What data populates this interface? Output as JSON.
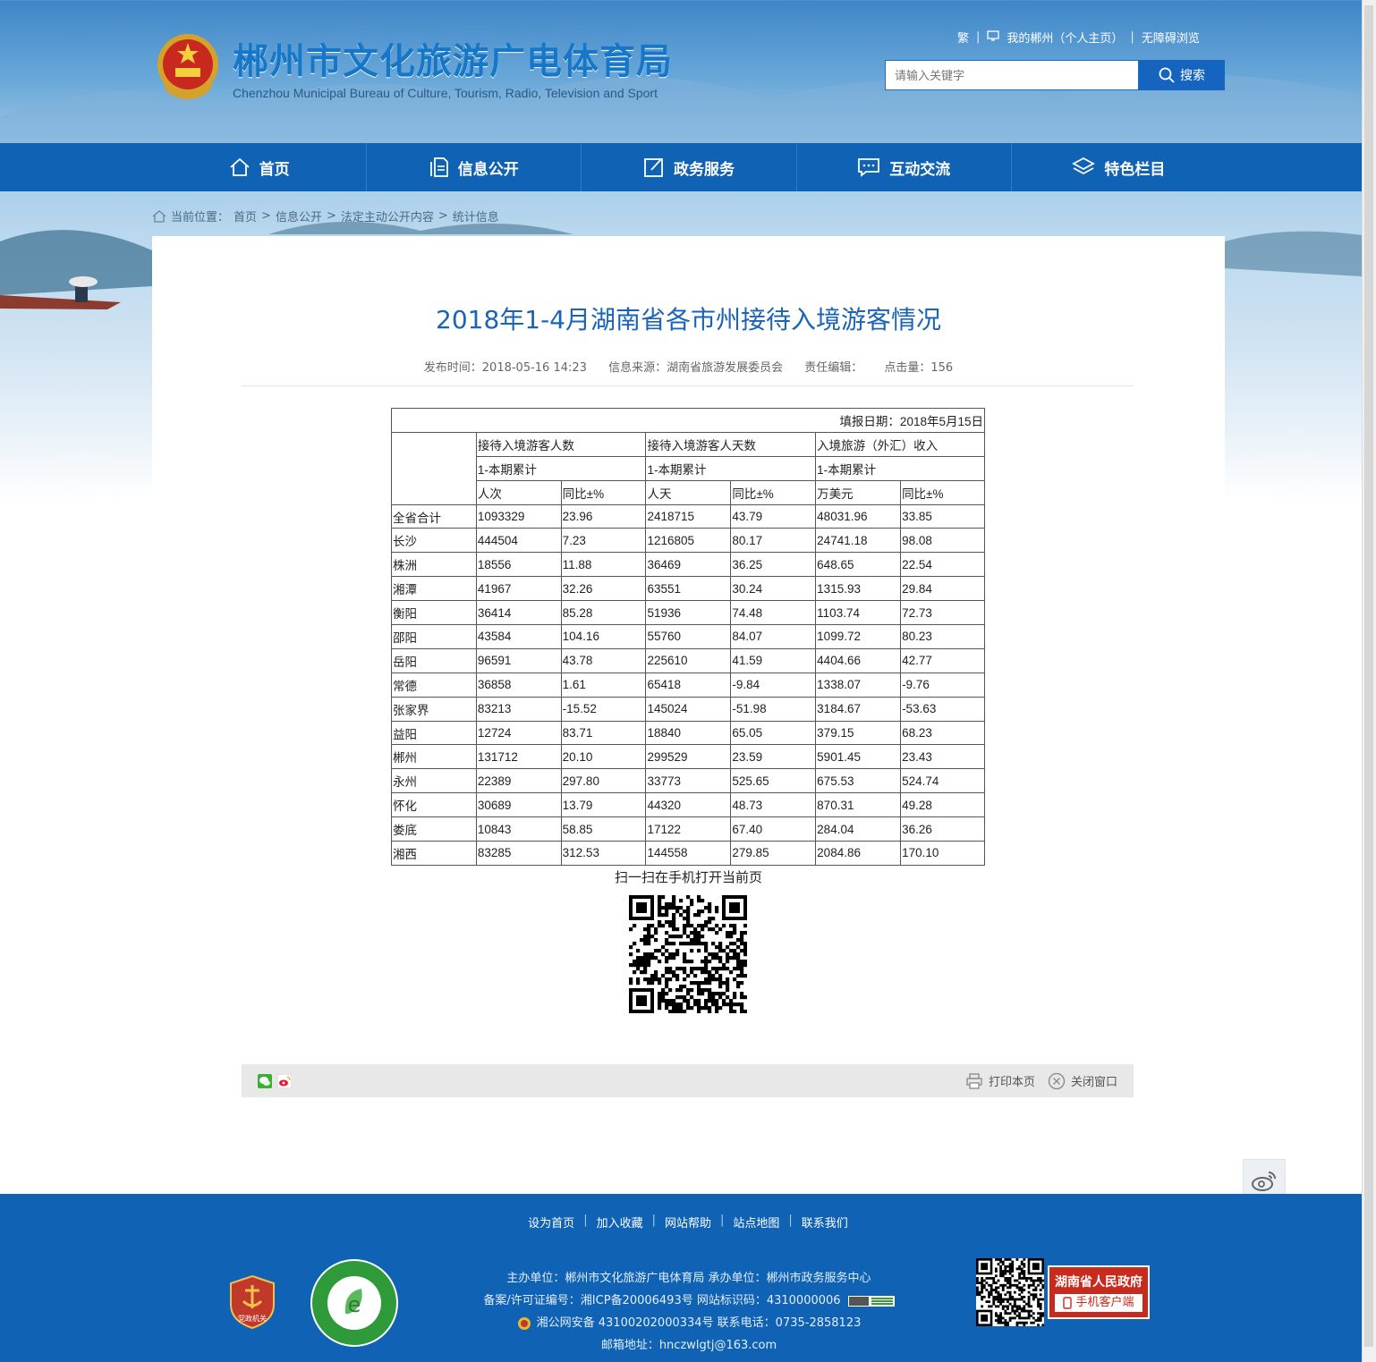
{
  "header": {
    "title": "郴州市文化旅游广电体育局",
    "subtitle": "Chenzhou Municipal Bureau of Culture, Tourism, Radio, Television and Sport",
    "top_links": [
      "繁",
      "我的郴州（个人主页）",
      "无障碍浏览"
    ],
    "search_placeholder": "请输入关键字",
    "search_label": "搜索"
  },
  "nav": [
    {
      "label": "首页",
      "icon": "home-icon"
    },
    {
      "label": "信息公开",
      "icon": "document-icon"
    },
    {
      "label": "政务服务",
      "icon": "edit-icon"
    },
    {
      "label": "互动交流",
      "icon": "chat-icon"
    },
    {
      "label": "特色栏目",
      "icon": "layers-icon"
    }
  ],
  "breadcrumb": {
    "prefix": "当前位置：",
    "items": [
      "首页",
      "信息公开",
      "法定主动公开内容",
      "统计信息"
    ]
  },
  "article": {
    "title": "2018年1-4月湖南省各市州接待入境游客情况",
    "publish_time": "发布时间：2018-05-16 14:23",
    "source": "信息来源：湖南省旅游发展委员会",
    "editor": "责任编辑：",
    "clicks": "点击量：156"
  },
  "table": {
    "fill_date": "填报日期：2018年5月15日",
    "groups": [
      "接待入境游客人数",
      "接待入境游客人天数",
      "入境旅游（外汇）收入"
    ],
    "period": "1-本期累计",
    "units": [
      "人次",
      "同比±%",
      "人天",
      "同比±%",
      "万美元",
      "同比±%"
    ],
    "rows": [
      [
        "全省合计",
        "1093329",
        "23.96",
        "2418715",
        "43.79",
        "48031.96",
        "33.85"
      ],
      [
        "长沙",
        "444504",
        "7.23",
        "1216805",
        "80.17",
        "24741.18",
        "98.08"
      ],
      [
        "株洲",
        "18556",
        "11.88",
        "36469",
        "36.25",
        "648.65",
        "22.54"
      ],
      [
        "湘潭",
        "41967",
        "32.26",
        "63551",
        "30.24",
        "1315.93",
        "29.84"
      ],
      [
        "衡阳",
        "36414",
        "85.28",
        "51936",
        "74.48",
        "1103.74",
        "72.73"
      ],
      [
        "邵阳",
        "43584",
        "104.16",
        "55760",
        "84.07",
        "1099.72",
        "80.23"
      ],
      [
        "岳阳",
        "96591",
        "43.78",
        "225610",
        "41.59",
        "4404.66",
        "42.77"
      ],
      [
        "常德",
        "36858",
        "1.61",
        "65418",
        "-9.84",
        "1338.07",
        "-9.76"
      ],
      [
        "张家界",
        "83213",
        "-15.52",
        "145024",
        "-51.98",
        "3184.67",
        "-53.63"
      ],
      [
        "益阳",
        "12724",
        "83.71",
        "18840",
        "65.05",
        "379.15",
        "68.23"
      ],
      [
        "郴州",
        "131712",
        "20.10",
        "299529",
        "23.59",
        "5901.45",
        "23.43"
      ],
      [
        "永州",
        "22389",
        "297.80",
        "33773",
        "525.65",
        "675.53",
        "524.74"
      ],
      [
        "怀化",
        "30689",
        "13.79",
        "44320",
        "48.73",
        "870.31",
        "49.28"
      ],
      [
        "娄底",
        "10843",
        "58.85",
        "17122",
        "67.40",
        "284.04",
        "36.26"
      ],
      [
        "湘西",
        "83285",
        "312.53",
        "144558",
        "279.85",
        "2084.86",
        "170.10"
      ]
    ]
  },
  "qr_caption": "扫一扫在手机打开当前页",
  "tools": {
    "print": "打印本页",
    "close": "关闭窗口"
  },
  "footer": {
    "links": [
      "设为首页",
      "加入收藏",
      "网站帮助",
      "站点地图",
      "联系我们"
    ],
    "line1": "主办单位：郴州市文化旅游广电体育局   承办单位：郴州市政务服务中心",
    "line2": "备案/许可证编号：湘ICP备20006493号   网站标识码：4310000006",
    "line3": "湘公网安备 43100202000334号   联系电话：0735-2858123",
    "line4": "邮箱地址：hnczwlgtj@163.com",
    "app_title": "湖南省人民政府",
    "app_sub": "手机客户端",
    "badge_text": "党政机关"
  },
  "colors": {
    "primary": "#0f62b4",
    "title_blue": "#1a64b8",
    "badge_red": "#c82a1e"
  }
}
